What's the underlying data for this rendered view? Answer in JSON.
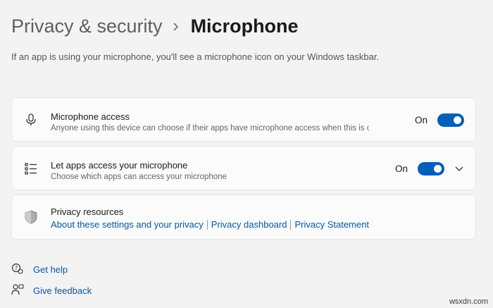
{
  "breadcrumb": {
    "parent": "Privacy & security",
    "current": "Microphone"
  },
  "intro": "If an app is using your microphone, you'll see a microphone icon on your Windows taskbar.",
  "microphone_access": {
    "title": "Microphone access",
    "subtitle": "Anyone using this device can choose if their apps have microphone access when this is on",
    "toggle_label": "On",
    "toggle_on": true,
    "icon": "microphone-icon"
  },
  "apps_access": {
    "title": "Let apps access your microphone",
    "subtitle": "Choose which apps can access your microphone",
    "toggle_label": "On",
    "toggle_on": true,
    "icon": "list-icon",
    "expand_icon": "chevron-down-icon"
  },
  "privacy_resources": {
    "title": "Privacy resources",
    "icon": "shield-icon",
    "links": [
      "About these settings and your privacy",
      "Privacy dashboard",
      "Privacy Statement"
    ]
  },
  "footer": {
    "help": "Get help",
    "feedback": "Give feedback"
  },
  "watermark": "wsxdn.com",
  "colors": {
    "accent": "#005fb8",
    "link": "#0358a7",
    "background": "#f3f3f3",
    "card": "#fbfbfb"
  }
}
